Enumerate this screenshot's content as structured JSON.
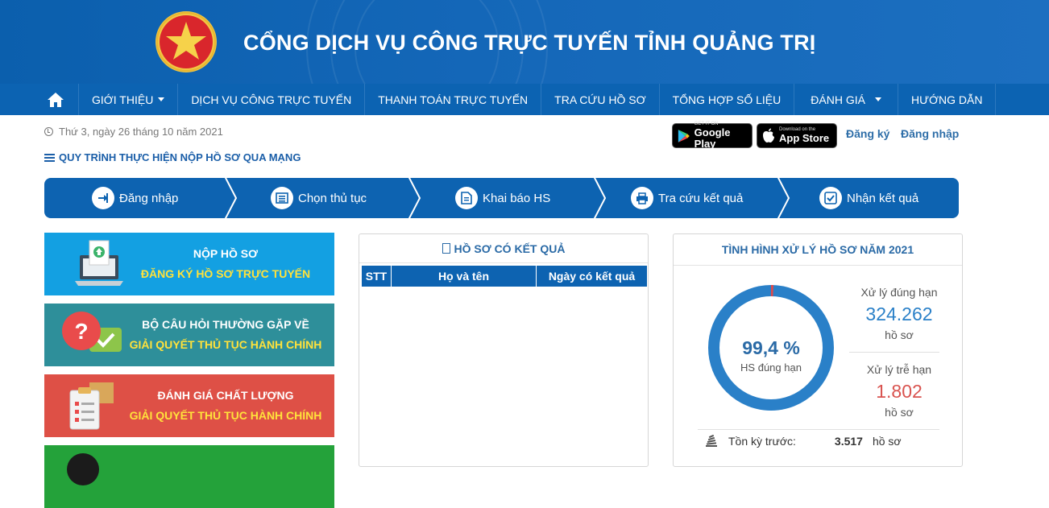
{
  "header": {
    "title": "CỔNG DỊCH VỤ CÔNG TRỰC TUYẾN TỈNH QUẢNG TRỊ"
  },
  "nav": {
    "home_icon": "home-icon",
    "items": [
      {
        "label": "GIỚI THIỆU",
        "dropdown": true
      },
      {
        "label": "DỊCH VỤ CÔNG TRỰC TUYẾN"
      },
      {
        "label": "THANH TOÁN TRỰC TUYẾN"
      },
      {
        "label": "TRA CỨU HỒ SƠ"
      },
      {
        "label": "TỔNG HỢP SỐ LIỆU"
      },
      {
        "label": "ĐÁNH GIÁ",
        "dropdown": true
      },
      {
        "label": "HƯỚNG DẪN"
      }
    ]
  },
  "date_text": "Thứ 3, ngày 26 tháng 10 năm 2021",
  "procedure_title": "QUY TRÌNH THỰC HIỆN NỘP HỒ SƠ QUA MẠNG",
  "stores": {
    "google_small": "GET IT ON",
    "google_big": "Google Play",
    "apple_small": "Download on the",
    "apple_big": "App Store"
  },
  "auth": {
    "register": "Đăng ký",
    "login": "Đăng nhập"
  },
  "steps": [
    "Đăng nhập",
    "Chọn thủ tục",
    "Khai báo HS",
    "Tra cứu kết quả",
    "Nhận kết quả"
  ],
  "banners": [
    {
      "line1": "NỘP HỒ SƠ",
      "line2": "ĐĂNG KÝ HỒ SƠ TRỰC TUYẾN",
      "color": "#13a0e2"
    },
    {
      "line1": "BỘ CÂU HỎI THƯỜNG GẶP VỀ",
      "line2": "GIẢI QUYẾT THỦ TỤC HÀNH CHÍNH",
      "color": "#2e8f9a"
    },
    {
      "line1": "ĐÁNH GIÁ CHẤT LƯỢNG",
      "line2": "GIẢI QUYẾT THỦ TỤC HÀNH CHÍNH",
      "color": "#de5046"
    },
    {
      "line1": "",
      "line2": "",
      "color": "#24a23a"
    }
  ],
  "results_panel": {
    "title": "HỒ SƠ CÓ KẾT QUẢ",
    "columns": [
      "STT",
      "Họ và tên",
      "Ngày có kết quả"
    ]
  },
  "stats_panel": {
    "title": "TÌNH HÌNH XỬ LÝ HỒ SƠ NĂM 2021",
    "percent_label": "99,4 %",
    "percent_value": 99.4,
    "percent_sub": "HS đúng hạn",
    "on_time_label": "Xử lý đúng hạn",
    "on_time_value": "324.262",
    "late_label": "Xử lý trễ hạn",
    "late_value": "1.802",
    "unit": "hồ sơ",
    "backlog_label": "Tồn kỳ trước:",
    "backlog_value": "3.517",
    "colors": {
      "ontime": "#2a80c8",
      "late": "#e0484a"
    }
  }
}
